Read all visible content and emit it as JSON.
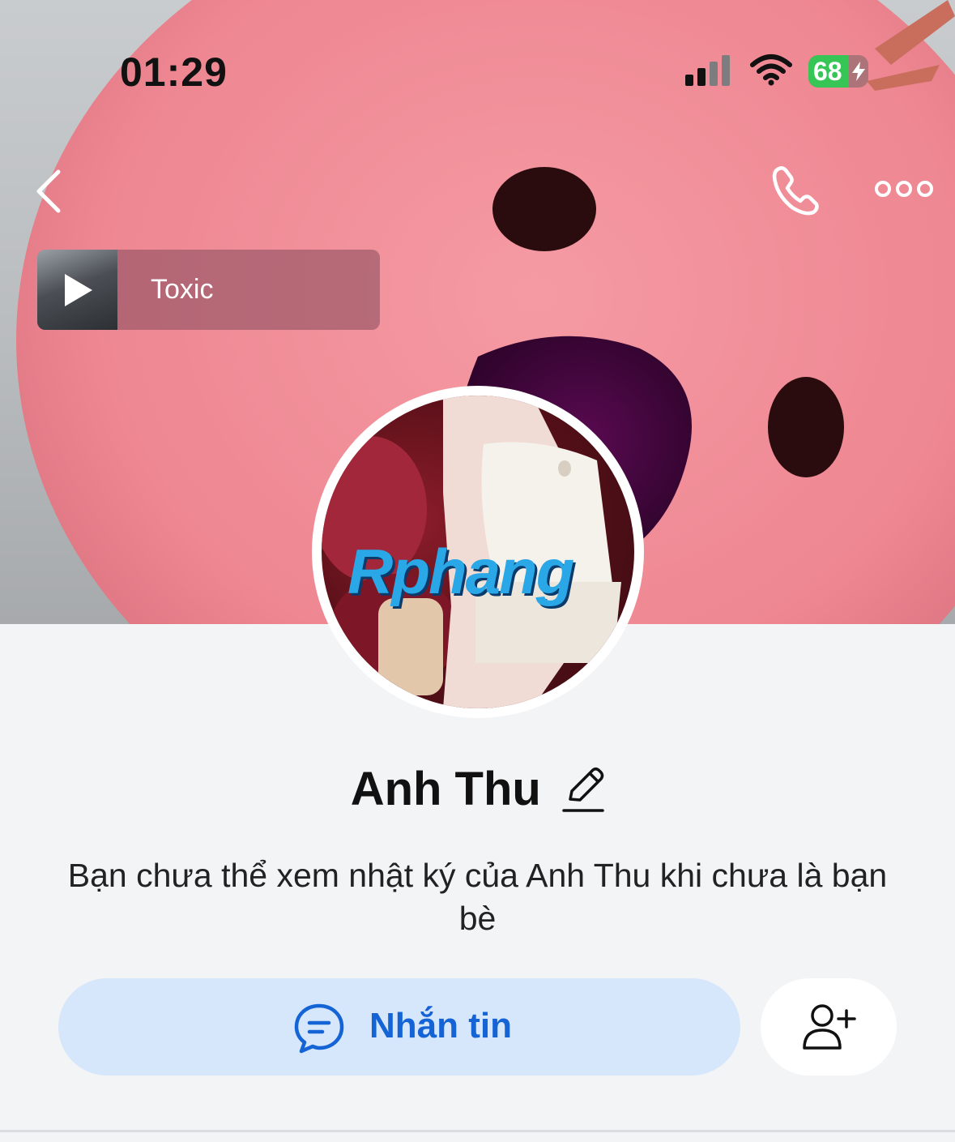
{
  "status_bar": {
    "time": "01:29",
    "battery": "68",
    "battery_level": 0.68
  },
  "nav": {
    "back_icon": "chevron-left-icon",
    "call_icon": "phone-icon",
    "more_icon": "more-horizontal-icon"
  },
  "music": {
    "title": "Toxic",
    "play_icon": "play-icon"
  },
  "avatar": {
    "watermark": "Rphang"
  },
  "profile": {
    "name": "Anh Thu",
    "edit_icon": "pencil-icon",
    "notice": "Bạn chưa thể xem nhật ký của Anh Thu khi chưa là bạn bè"
  },
  "actions": {
    "message_label": "Nhắn tin",
    "message_icon": "chat-bubble-icon",
    "add_friend_icon": "add-user-icon"
  },
  "colors": {
    "accent": "#1564d6",
    "message_button_bg": "#d6e7fb",
    "battery_fill": "#37c556",
    "page_bg": "#f3f4f6"
  }
}
